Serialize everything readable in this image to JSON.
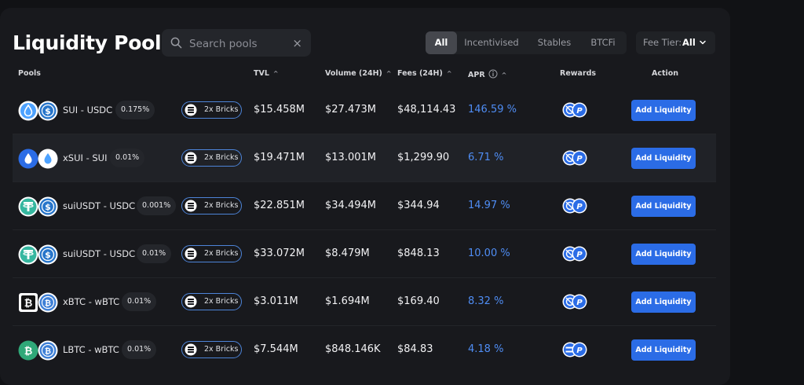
{
  "page_title": "Liquidity Pools",
  "search": {
    "placeholder": "Search pools",
    "value": ""
  },
  "filters": {
    "tabs": [
      {
        "label": "All",
        "active": true
      },
      {
        "label": "Incentivised",
        "active": false
      },
      {
        "label": "Stables",
        "active": false
      },
      {
        "label": "BTCFi",
        "active": false
      }
    ],
    "fee_tier": {
      "label": "Fee Tier:",
      "value": "All"
    }
  },
  "columns": {
    "pools": "Pools",
    "tvl": "TVL",
    "volume": "Volume (24H)",
    "fees": "Fees (24H)",
    "apr": "APR",
    "rewards": "Rewards",
    "action": "Action"
  },
  "rows": [
    {
      "pair": "SUI - USDC",
      "fee": "0.175%",
      "bricks": "2x Bricks",
      "tvl": "$15.458M",
      "volume": "$27.473M",
      "fees": "$48,114.43",
      "apr": "146.59 %",
      "action": "Add Liquidity",
      "token1": "sui-icon",
      "token2": "usdc-icon"
    },
    {
      "pair": "xSUI - SUI",
      "fee": "0.01%",
      "bricks": "2x Bricks",
      "tvl": "$19.471M",
      "volume": "$13.001M",
      "fees": "$1,299.90",
      "apr": "6.71 %",
      "action": "Add Liquidity",
      "token1": "xsui-icon",
      "token2": "sui-icon"
    },
    {
      "pair": "suiUSDT - USDC",
      "fee": "0.001%",
      "bricks": "2x Bricks",
      "tvl": "$22.851M",
      "volume": "$34.494M",
      "fees": "$344.94",
      "apr": "14.97 %",
      "action": "Add Liquidity",
      "token1": "usdt-icon",
      "token2": "usdc-icon"
    },
    {
      "pair": "suiUSDT - USDC",
      "fee": "0.01%",
      "bricks": "2x Bricks",
      "tvl": "$33.072M",
      "volume": "$8.479M",
      "fees": "$848.13",
      "apr": "10.00 %",
      "action": "Add Liquidity",
      "token1": "usdt-icon",
      "token2": "usdc-icon"
    },
    {
      "pair": "xBTC - wBTC",
      "fee": "0.01%",
      "bricks": "2x Bricks",
      "tvl": "$3.011M",
      "volume": "$1.694M",
      "fees": "$169.40",
      "apr": "8.32 %",
      "action": "Add Liquidity",
      "token1": "xbtc-icon",
      "token2": "wbtc-icon"
    },
    {
      "pair": "LBTC - wBTC",
      "fee": "0.01%",
      "bricks": "2x Bricks",
      "tvl": "$7.544M",
      "volume": "$848.146K",
      "fees": "$84.83",
      "apr": "4.18 %",
      "action": "Add Liquidity",
      "token1": "lbtc-icon",
      "token2": "wbtc-icon"
    }
  ],
  "colors": {
    "accent": "#2b6ce6",
    "apr_text": "#4f8df4",
    "bricks_border": "#4d84d8",
    "panel_bg": "#18191d",
    "page_bg": "#111215"
  }
}
